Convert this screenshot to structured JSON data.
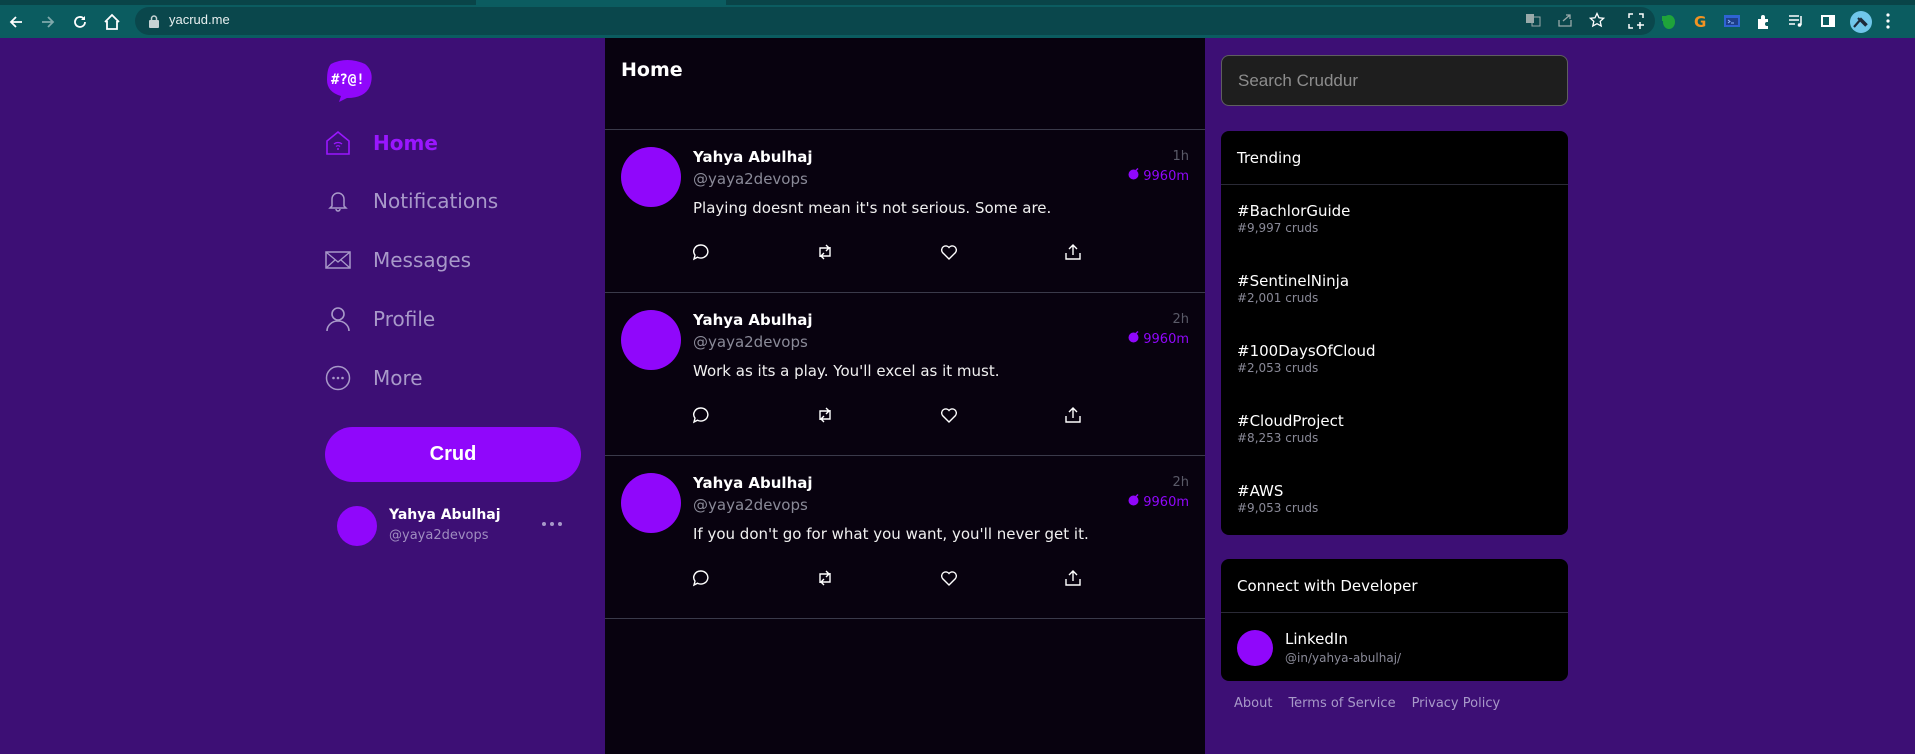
{
  "browser": {
    "url": "yacrud.me",
    "icons": [
      "back-icon",
      "forward-icon",
      "reload-icon",
      "home-icon",
      "lock-icon",
      "translate-icon",
      "share-icon",
      "bookmark-star-icon",
      "screenshot-icon",
      "evernote-icon",
      "grammarly-icon",
      "terminal-icon",
      "extensions-icon",
      "media-icon",
      "side-panel-icon",
      "profile-icon",
      "menu-icon"
    ]
  },
  "brand": {
    "logo_text": "#?@!",
    "accent": "#9007fb",
    "page_bg": "#3d0f75",
    "feed_bg": "#08020f"
  },
  "sidebar": {
    "items": [
      {
        "label": "Home",
        "icon": "home-icon",
        "active": true
      },
      {
        "label": "Notifications",
        "icon": "bell-icon",
        "active": false
      },
      {
        "label": "Messages",
        "icon": "envelope-icon",
        "active": false
      },
      {
        "label": "Profile",
        "icon": "user-icon",
        "active": false
      },
      {
        "label": "More",
        "icon": "more-circle-icon",
        "active": false
      }
    ],
    "crud_button": "Crud",
    "user": {
      "name": "Yahya Abulhaj",
      "handle": "@yaya2devops"
    }
  },
  "feed": {
    "title": "Home",
    "posts": [
      {
        "name": "Yahya Abulhaj",
        "handle": "@yaya2devops",
        "text": "Playing doesnt mean it's not serious. Some are.",
        "time": "1h",
        "score": "9960m"
      },
      {
        "name": "Yahya Abulhaj",
        "handle": "@yaya2devops",
        "text": "Work as its a play. You'll excel as it must.",
        "time": "2h",
        "score": "9960m"
      },
      {
        "name": "Yahya Abulhaj",
        "handle": "@yaya2devops",
        "text": "If you don't go for what you want, you'll never get it.",
        "time": "2h",
        "score": "9960m"
      }
    ]
  },
  "right": {
    "search_placeholder": "Search Cruddur",
    "trending": {
      "title": "Trending",
      "items": [
        {
          "tag": "#BachlorGuide",
          "count": "#9,997 cruds"
        },
        {
          "tag": "#SentinelNinja",
          "count": "#2,001 cruds"
        },
        {
          "tag": "#100DaysOfCloud",
          "count": "#2,053 cruds"
        },
        {
          "tag": "#CloudProject",
          "count": "#8,253 cruds"
        },
        {
          "tag": "#AWS",
          "count": "#9,053 cruds"
        }
      ]
    },
    "connect": {
      "title": "Connect with Developer",
      "items": [
        {
          "title": "LinkedIn",
          "subtitle": "@in/yahya-abulhaj/"
        }
      ]
    },
    "footer": [
      "About",
      "Terms of Service",
      "Privacy Policy"
    ]
  }
}
